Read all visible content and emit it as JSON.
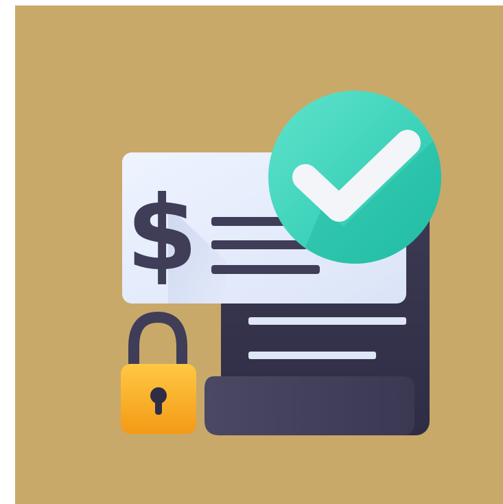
{
  "icon": {
    "name": "secure-payment-verified",
    "parts": [
      "dollar-sign-icon",
      "check-icon",
      "padlock-icon",
      "document-icon"
    ]
  },
  "colors": {
    "background": "#c8a96a",
    "card": "#e8eefb",
    "document": "#3f3d57",
    "check_badge": "#3dd6bd",
    "padlock": "#f7b52c",
    "lines": "#3f3d57"
  },
  "glyphs": {
    "dollar": "$"
  }
}
